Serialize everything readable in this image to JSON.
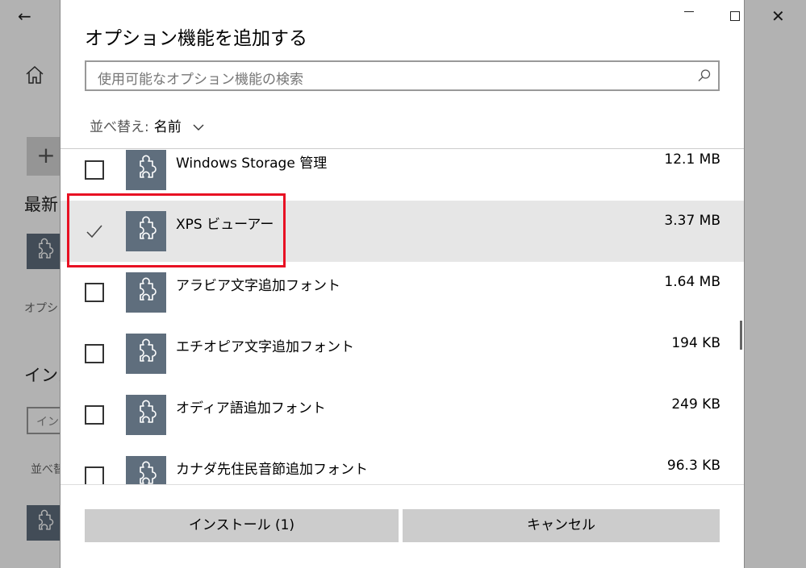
{
  "background": {
    "heading_partial": "最新",
    "section_heading_partial": "インス",
    "options_label_partial": "オプシ",
    "input_partial": "イン",
    "sort_label_partial": "並べ替",
    "add_symbol": "+"
  },
  "dialog": {
    "title": "オプション機能を追加する",
    "search": {
      "placeholder": "使用可能なオプション機能の検索"
    },
    "sort": {
      "label": "並べ替え:",
      "value": "名前"
    },
    "items": [
      {
        "name": "Windows Storage 管理",
        "size": "12.1 MB",
        "checked": false
      },
      {
        "name": "XPS ビューアー",
        "size": "3.37 MB",
        "checked": true
      },
      {
        "name": "アラビア文字追加フォント",
        "size": "1.64 MB",
        "checked": false
      },
      {
        "name": "エチオピア文字追加フォント",
        "size": "194 KB",
        "checked": false
      },
      {
        "name": "オディア語追加フォント",
        "size": "249 KB",
        "checked": false
      },
      {
        "name": "カナダ先住民音節追加フォント",
        "size": "96.3 KB",
        "checked": false
      }
    ],
    "buttons": {
      "install": "インストール (1)",
      "cancel": "キャンセル"
    }
  },
  "colors": {
    "tile": "#5f6e7d",
    "highlight": "#e81123",
    "selected_row": "#e6e6e6",
    "button": "#cccccc"
  },
  "icons": [
    "back-arrow-icon",
    "home-icon",
    "search-icon",
    "chevron-down-icon",
    "puzzle-icon",
    "checkmark-icon",
    "minimize-icon",
    "maximize-icon",
    "close-icon"
  ]
}
